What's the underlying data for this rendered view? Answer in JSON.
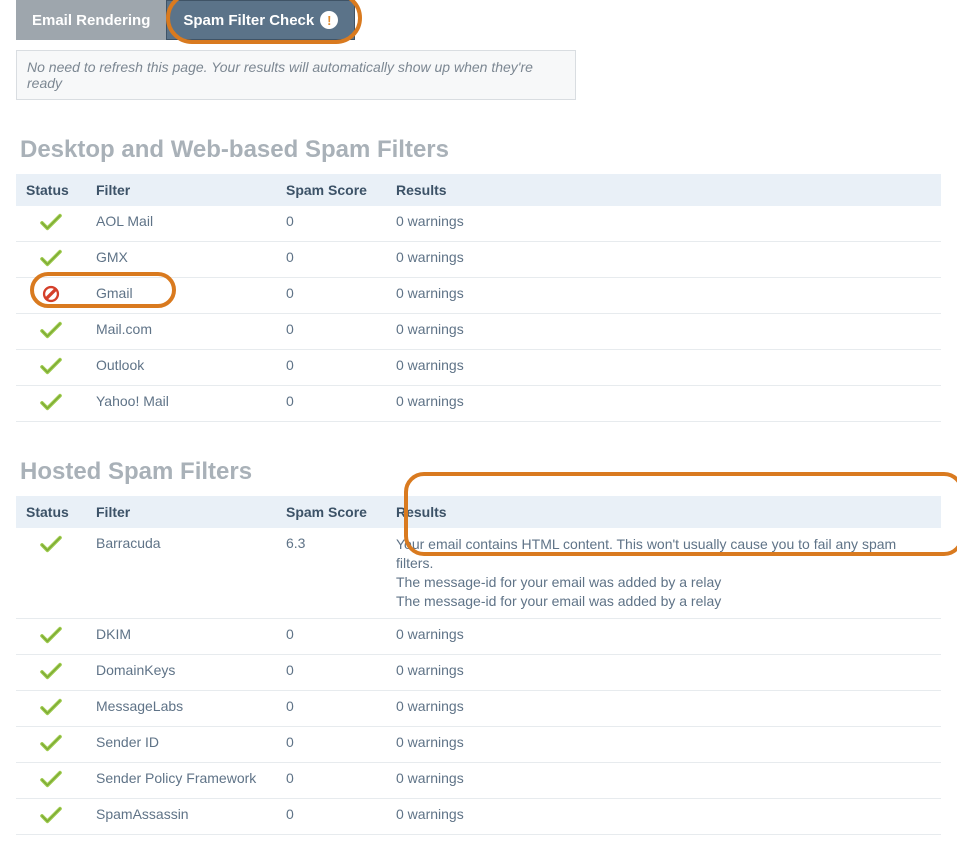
{
  "tabs": {
    "rendering_label": "Email Rendering",
    "spam_label": "Spam Filter Check",
    "badge": "!"
  },
  "notice": "No need to refresh this page. Your results will automatically show up when they're ready",
  "sections": {
    "desktop": {
      "title": "Desktop and Web-based Spam Filters",
      "headers": {
        "status": "Status",
        "filter": "Filter",
        "score": "Spam Score",
        "results": "Results"
      },
      "rows": [
        {
          "status": "ok",
          "filter": "AOL Mail",
          "score": "0",
          "results": "0 warnings"
        },
        {
          "status": "ok",
          "filter": "GMX",
          "score": "0",
          "results": "0 warnings"
        },
        {
          "status": "fail",
          "filter": "Gmail",
          "score": "0",
          "results": "0 warnings"
        },
        {
          "status": "ok",
          "filter": "Mail.com",
          "score": "0",
          "results": "0 warnings"
        },
        {
          "status": "ok",
          "filter": "Outlook",
          "score": "0",
          "results": "0 warnings"
        },
        {
          "status": "ok",
          "filter": "Yahoo! Mail",
          "score": "0",
          "results": "0 warnings"
        }
      ]
    },
    "hosted": {
      "title": "Hosted Spam Filters",
      "headers": {
        "status": "Status",
        "filter": "Filter",
        "score": "Spam Score",
        "results": "Results"
      },
      "rows": [
        {
          "status": "ok",
          "filter": "Barracuda",
          "score": "6.3",
          "results_lines": [
            "Your email contains HTML content. This won't usually cause you to fail any spam filters.",
            "The message-id for your email was added by a relay",
            "The message-id for your email was added by a relay"
          ]
        },
        {
          "status": "ok",
          "filter": "DKIM",
          "score": "0",
          "results": "0 warnings"
        },
        {
          "status": "ok",
          "filter": "DomainKeys",
          "score": "0",
          "results": "0 warnings"
        },
        {
          "status": "ok",
          "filter": "MessageLabs",
          "score": "0",
          "results": "0 warnings"
        },
        {
          "status": "ok",
          "filter": "Sender ID",
          "score": "0",
          "results": "0 warnings"
        },
        {
          "status": "ok",
          "filter": "Sender Policy Framework",
          "score": "0",
          "results": "0 warnings"
        },
        {
          "status": "ok",
          "filter": "SpamAssassin",
          "score": "0",
          "results": "0 warnings"
        }
      ]
    }
  },
  "colors": {
    "highlight": "#d97a1f",
    "tab_active": "#5b7389",
    "tab_inactive": "#9ea6ad",
    "header_bg": "#e9f0f7",
    "text_muted": "#5f7387"
  }
}
